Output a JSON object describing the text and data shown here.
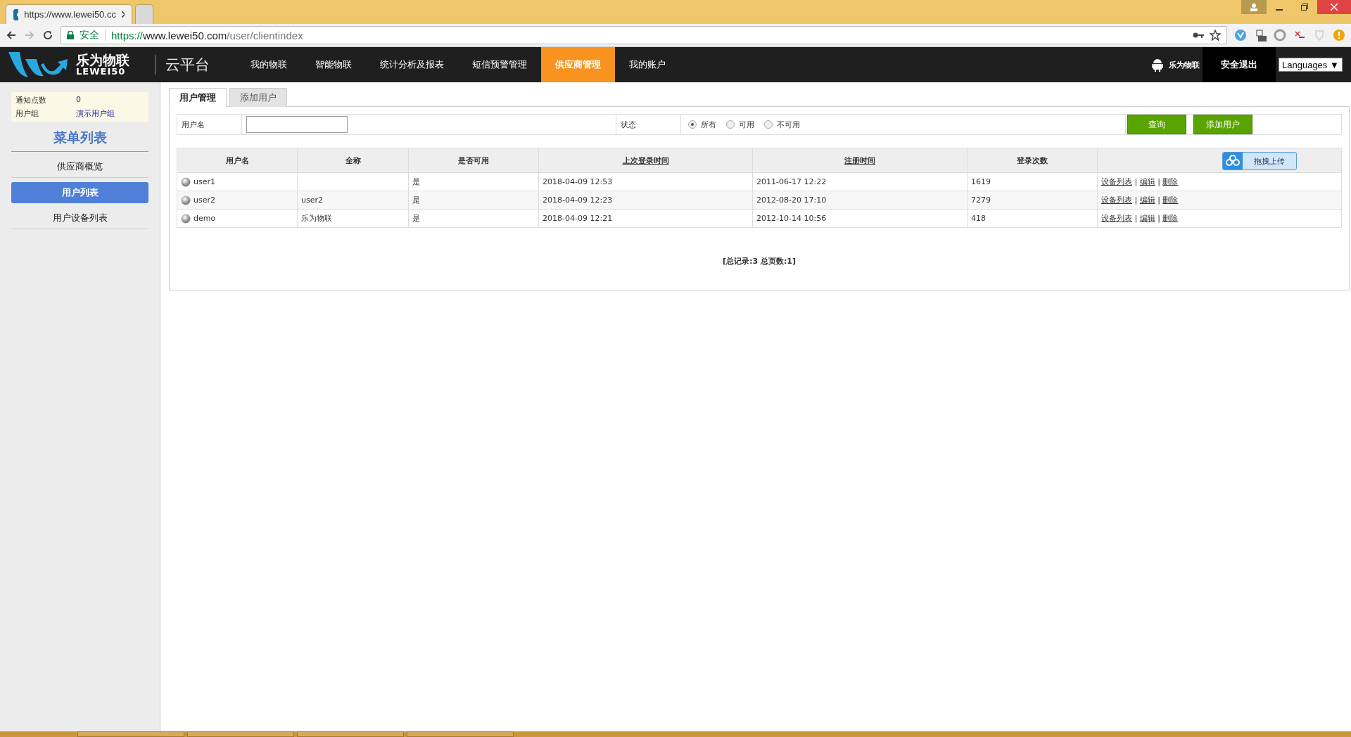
{
  "browser": {
    "tabs": [
      {
        "title": "https://www.lewei50.cc",
        "selected": true
      },
      {
        "selected": false
      }
    ],
    "security": "安全",
    "url": {
      "scheme": "https://",
      "host": "www.lewei50.com",
      "path": "/user/clientindex"
    }
  },
  "header": {
    "logo": {
      "name": "乐为物联",
      "latin": "LEWEI50"
    },
    "product": "云平台",
    "nav": [
      {
        "label": "我的物联",
        "selected": false
      },
      {
        "label": "智能物联",
        "selected": false
      },
      {
        "label": "统计分析及报表",
        "selected": false
      },
      {
        "label": "短信预警管理",
        "selected": false
      },
      {
        "label": "供应商管理",
        "selected": true
      },
      {
        "label": "我的账户",
        "selected": false
      }
    ],
    "app_label": "乐为物联",
    "logout": "安全退出",
    "languages": "Languages ▼"
  },
  "sidebar": {
    "info": [
      {
        "label": "通知点数",
        "value": "0",
        "kind": "text"
      },
      {
        "label": "用户组",
        "value": "演示用户组",
        "kind": "link"
      }
    ],
    "menu_title": "菜单列表",
    "items": [
      {
        "label": "供应商概览",
        "selected": false
      },
      {
        "label": "用户列表",
        "selected": true
      },
      {
        "label": "用户设备列表",
        "selected": false
      }
    ]
  },
  "tabs": [
    {
      "label": "用户管理",
      "selected": true
    },
    {
      "label": "添加用户",
      "selected": false
    }
  ],
  "filter": {
    "username_label": "用户名",
    "status_label": "状态",
    "status_options": [
      {
        "label": "所有",
        "selected": true
      },
      {
        "label": "可用",
        "selected": false
      },
      {
        "label": "不可用",
        "selected": false
      }
    ],
    "buttons": [
      "查询",
      "添加用户"
    ]
  },
  "table": {
    "columns": [
      {
        "label": "用户名",
        "sortable": false
      },
      {
        "label": "全称",
        "sortable": false
      },
      {
        "label": "是否可用",
        "sortable": false
      },
      {
        "label": "上次登录时间",
        "sortable": true
      },
      {
        "label": "注册时间",
        "sortable": true
      },
      {
        "label": "登录次数",
        "sortable": false
      }
    ],
    "action_separator": "|",
    "rows": [
      {
        "username": "user1",
        "fullname": "",
        "enabled": "是",
        "last_login": "2018-04-09 12:53",
        "registered": "2011-06-17 12:22",
        "logins": "1619",
        "actions": [
          "设备列表",
          "编辑",
          "删除"
        ]
      },
      {
        "username": "user2",
        "fullname": "user2",
        "enabled": "是",
        "last_login": "2018-04-09 12:23",
        "registered": "2012-08-20 17:10",
        "logins": "7279",
        "actions": [
          "设备列表",
          "编辑",
          "删除"
        ]
      },
      {
        "username": "demo",
        "fullname": "乐为物联",
        "enabled": "是",
        "last_login": "2018-04-09 12:21",
        "registered": "2012-10-14 10:56",
        "logins": "418",
        "actions": [
          "设备列表",
          "编辑",
          "删除"
        ]
      }
    ]
  },
  "pager": "[总记录:3 总页数:1]",
  "upload_widget": "拖拽上传"
}
